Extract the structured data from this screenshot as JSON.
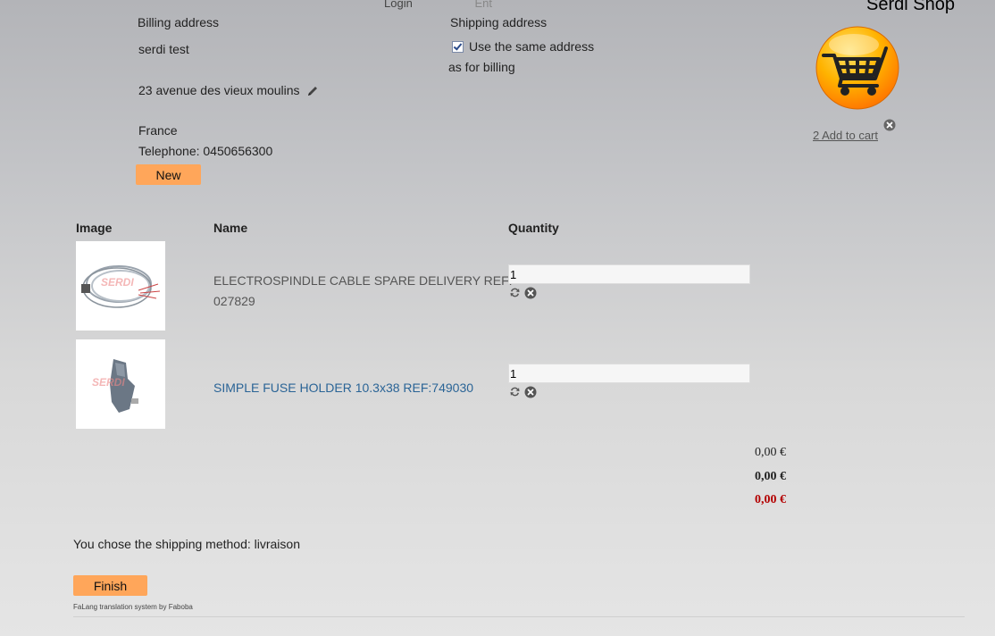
{
  "nav": {
    "login": "Login",
    "item2": "Ent"
  },
  "shop": {
    "title": "Serdi Shop",
    "cart_link": "2 Add to cart"
  },
  "billing": {
    "heading": "Billing address",
    "name": "serdi test",
    "street": "23 avenue des vieux moulins",
    "country": "France",
    "telephone": "Telephone: 0450656300",
    "new_button": "New"
  },
  "shipping": {
    "heading": "Shipping address",
    "same_line1": "Use the same address",
    "same_line2": "as for billing",
    "same_checked": true
  },
  "table": {
    "headers": {
      "image": "Image",
      "name": "Name",
      "quantity": "Quantity"
    },
    "rows": [
      {
        "name_line1": "ELECTROSPINDLE CABLE SPARE DELIVERY REF:",
        "name_line2": "027829",
        "quantity": "1"
      },
      {
        "name_line1": "SIMPLE FUSE HOLDER 10.3x38 REF:749030",
        "name_line2": "",
        "quantity": "1"
      }
    ]
  },
  "totals": {
    "subtotal": "0,00 €",
    "shipping": "0,00 €",
    "total": "0,00 €"
  },
  "shipping_method": "You chose the shipping method: livraison",
  "finish_button": "Finish",
  "footer": "FaLang translation system by Faboba",
  "colors": {
    "button": "#ffa65a",
    "link": "#2a6496",
    "total": "#b30000"
  }
}
